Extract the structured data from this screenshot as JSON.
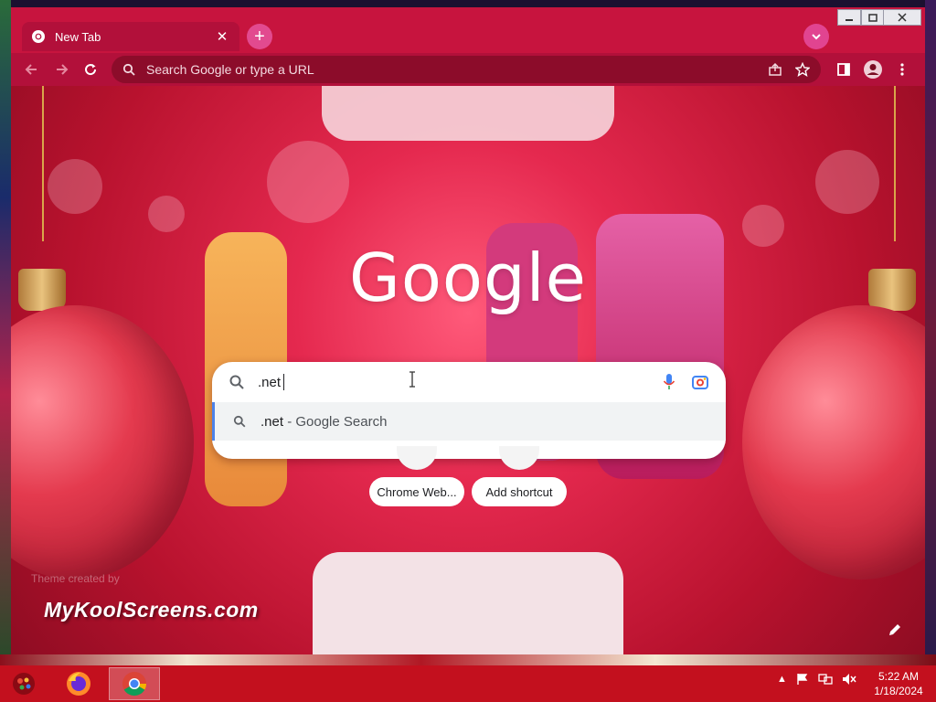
{
  "browser": {
    "tab": {
      "title": "New Tab"
    },
    "omnibox": {
      "placeholder": "Search Google or type a URL"
    }
  },
  "newtab": {
    "logo_text": "Google",
    "search": {
      "query": ".net",
      "suggestion_query": ".net",
      "suggestion_suffix": " - Google Search"
    },
    "shortcuts": [
      {
        "label": "Chrome Web..."
      },
      {
        "label": "Add shortcut"
      }
    ],
    "theme_credit": "Theme created by",
    "theme_brand": "MyKoolScreens.com"
  },
  "taskbar": {
    "time": "5:22 AM",
    "date": "1/18/2024"
  },
  "colors": {
    "titlebar": "#c7143e",
    "toolbar": "#b2103a",
    "omnibox": "#8c0c2a",
    "taskbar": "#c3101e",
    "accent": "#4d82e8"
  }
}
